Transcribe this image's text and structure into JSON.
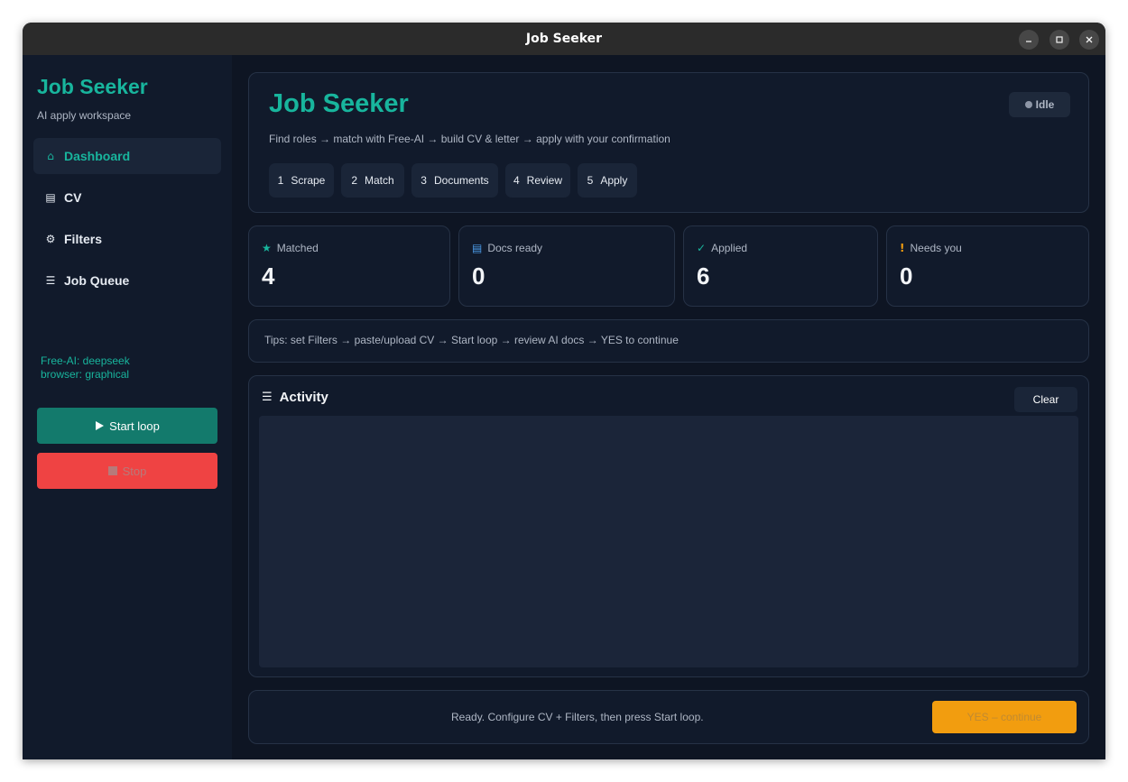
{
  "window": {
    "title": "Job Seeker"
  },
  "sidebar": {
    "brand": "Job Seeker",
    "subtitle": "AI apply workspace",
    "items": [
      {
        "label": "Dashboard",
        "icon": "home-icon",
        "glyph": "⌂",
        "active": true
      },
      {
        "label": "CV",
        "icon": "document-icon",
        "glyph": "▤",
        "active": false
      },
      {
        "label": "Filters",
        "icon": "gear-icon",
        "glyph": "⚙",
        "active": false
      },
      {
        "label": "Job Queue",
        "icon": "list-icon",
        "glyph": "☰",
        "active": false
      }
    ],
    "ai_info": "Free-AI: deepseek",
    "browser_info": "browser: graphical",
    "start_label": "Start loop",
    "stop_label": "Stop"
  },
  "hero": {
    "title": "Job Seeker",
    "subtitle": "Find roles → match with Free-AI → build CV & letter → apply with your confirmation",
    "status": "Idle",
    "steps": [
      {
        "num": "1",
        "label": "Scrape"
      },
      {
        "num": "2",
        "label": "Match"
      },
      {
        "num": "3",
        "label": "Documents"
      },
      {
        "num": "4",
        "label": "Review"
      },
      {
        "num": "5",
        "label": "Apply"
      }
    ]
  },
  "stats": [
    {
      "label": "Matched",
      "value": "4",
      "icon": "star-icon",
      "glyph": "★",
      "color": "#18b59d"
    },
    {
      "label": "Docs ready",
      "value": "0",
      "icon": "document-icon",
      "glyph": "▤",
      "color": "#4b9be8"
    },
    {
      "label": "Applied",
      "value": "6",
      "icon": "check-icon",
      "glyph": "✓",
      "color": "#18b59d"
    },
    {
      "label": "Needs you",
      "value": "0",
      "icon": "exclamation-icon",
      "glyph": "!",
      "color": "#f29d0f"
    }
  ],
  "tips": "Tips: set Filters → paste/upload CV → Start loop → review AI docs → YES to continue",
  "activity": {
    "title": "Activity",
    "clear_label": "Clear"
  },
  "footer": {
    "status_text": "Ready. Configure CV + Filters, then press Start loop.",
    "yes_label": "YES – continue"
  },
  "colors": {
    "accent": "#18b59d",
    "danger": "#ef4343",
    "warning": "#f29d0f",
    "background": "#0e1523",
    "panel": "#111a2b"
  }
}
